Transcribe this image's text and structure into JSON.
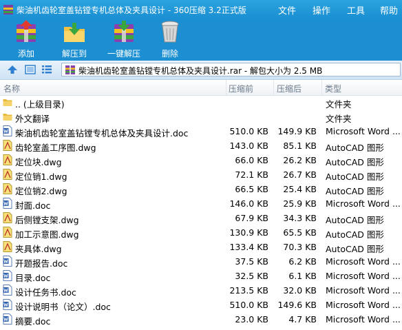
{
  "window": {
    "title": "柴油机齿轮室盖钻镗专机总体及夹具设计 - 360压缩 3.2正式版",
    "menus": [
      "文件",
      "操作",
      "工具",
      "帮助"
    ],
    "accent_color": "#1b8fd2"
  },
  "toolbar": {
    "add_label": "添加",
    "extract_label": "解压到",
    "oneclick_label": "一键解压",
    "delete_label": "删除"
  },
  "address": {
    "path": "柴油机齿轮室盖钻镗专机总体及夹具设计.rar - 解包大小为 2.5 MB"
  },
  "columns": {
    "name": "名称",
    "compressed_before": "压缩前",
    "compressed_after": "压缩后",
    "type": "类型"
  },
  "files": [
    {
      "name": ".. (上级目录)",
      "orig": "",
      "packed": "",
      "type": "文件夹",
      "icon": "folder-icon"
    },
    {
      "name": "外文翻译",
      "orig": "",
      "packed": "",
      "type": "文件夹",
      "icon": "folder-icon"
    },
    {
      "name": "柴油机齿轮室盖钻镗专机总体及夹具设计.doc",
      "orig": "510.0 KB",
      "packed": "149.9 KB",
      "type": "Microsoft Word ...",
      "icon": "word-doc-icon"
    },
    {
      "name": "齿轮室盖工序图.dwg",
      "orig": "143.0 KB",
      "packed": "85.1 KB",
      "type": "AutoCAD 图形",
      "icon": "autocad-dwg-icon"
    },
    {
      "name": "定位块.dwg",
      "orig": "66.0 KB",
      "packed": "26.2 KB",
      "type": "AutoCAD 图形",
      "icon": "autocad-dwg-icon"
    },
    {
      "name": "定位销1.dwg",
      "orig": "72.1 KB",
      "packed": "26.7 KB",
      "type": "AutoCAD 图形",
      "icon": "autocad-dwg-icon"
    },
    {
      "name": "定位销2.dwg",
      "orig": "66.5 KB",
      "packed": "25.4 KB",
      "type": "AutoCAD 图形",
      "icon": "autocad-dwg-icon"
    },
    {
      "name": "封面.doc",
      "orig": "146.0 KB",
      "packed": "25.9 KB",
      "type": "Microsoft Word ...",
      "icon": "word-doc-icon"
    },
    {
      "name": "后侧镗支架.dwg",
      "orig": "67.9 KB",
      "packed": "34.3 KB",
      "type": "AutoCAD 图形",
      "icon": "autocad-dwg-icon"
    },
    {
      "name": "加工示意图.dwg",
      "orig": "130.9 KB",
      "packed": "65.5 KB",
      "type": "AutoCAD 图形",
      "icon": "autocad-dwg-icon"
    },
    {
      "name": "夹具体.dwg",
      "orig": "133.4 KB",
      "packed": "70.3 KB",
      "type": "AutoCAD 图形",
      "icon": "autocad-dwg-icon"
    },
    {
      "name": "开题报告.doc",
      "orig": "37.5 KB",
      "packed": "6.2 KB",
      "type": "Microsoft Word ...",
      "icon": "word-doc-icon"
    },
    {
      "name": "目录.doc",
      "orig": "32.5 KB",
      "packed": "6.1 KB",
      "type": "Microsoft Word ...",
      "icon": "word-doc-icon"
    },
    {
      "name": "设计任务书.doc",
      "orig": "213.5 KB",
      "packed": "32.0 KB",
      "type": "Microsoft Word ...",
      "icon": "word-doc-icon"
    },
    {
      "name": "设计说明书（论文）.doc",
      "orig": "510.0 KB",
      "packed": "149.6 KB",
      "type": "Microsoft Word ...",
      "icon": "word-doc-icon"
    },
    {
      "name": "摘要.doc",
      "orig": "23.0 KB",
      "packed": "4.7 KB",
      "type": "Microsoft Word ...",
      "icon": "word-doc-icon"
    }
  ]
}
